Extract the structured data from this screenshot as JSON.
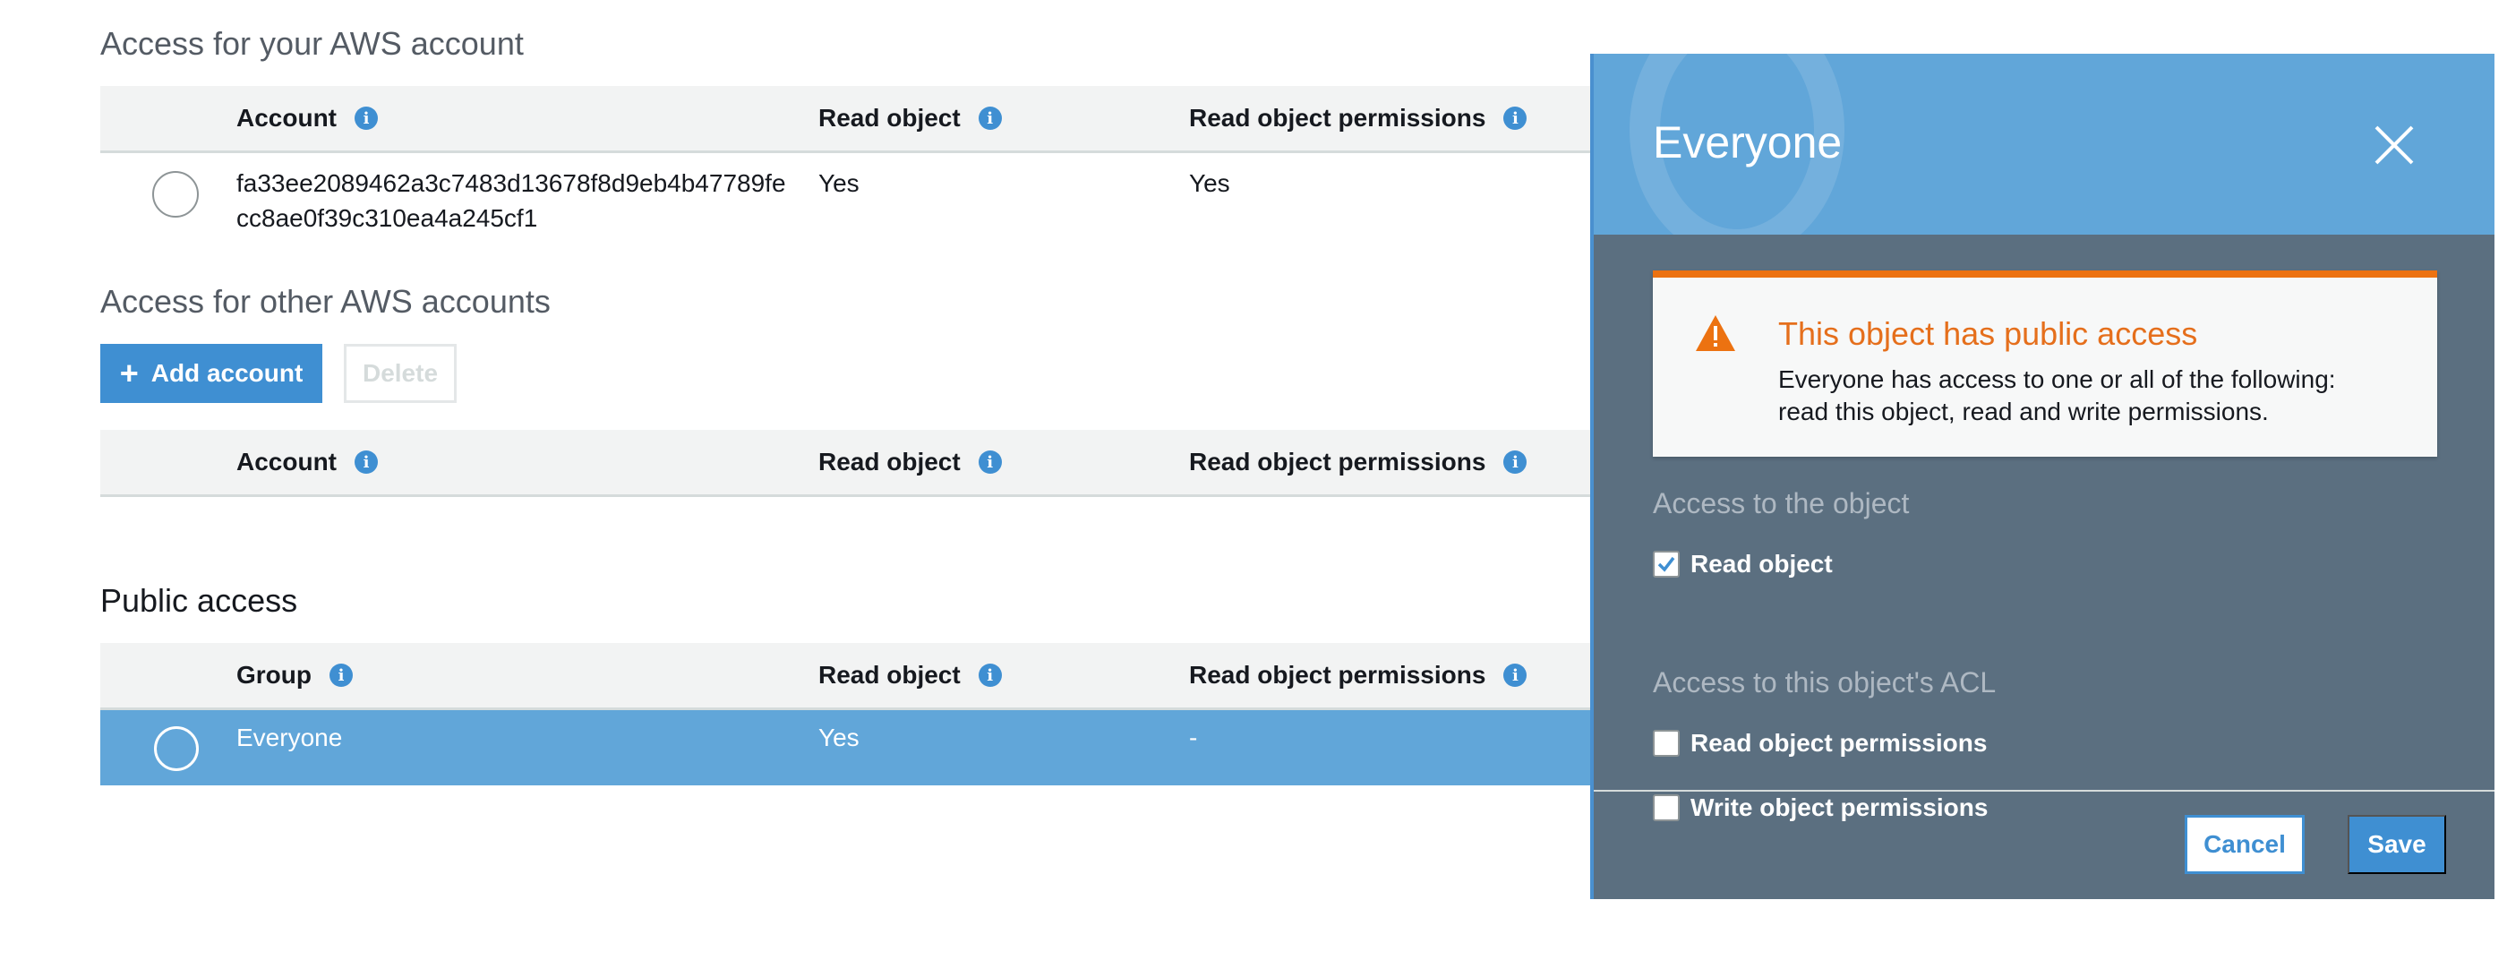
{
  "aws_account_section": {
    "title": "Access for your AWS account",
    "headers": {
      "account": "Account",
      "read_object": "Read object",
      "read_permissions": "Read object permissions"
    },
    "row": {
      "account_line1": "fa33ee2089462a3c7483d13678f8d9eb4b47789fe",
      "account_line2": "cc8ae0f39c310ea4a245cf1",
      "read_object": "Yes",
      "read_permissions": "Yes"
    }
  },
  "other_accounts_section": {
    "title": "Access for other AWS accounts",
    "add_button": "Add account",
    "delete_button": "Delete",
    "headers": {
      "account": "Account",
      "read_object": "Read object",
      "read_permissions": "Read object permissions"
    }
  },
  "public_access_section": {
    "title": "Public access",
    "headers": {
      "group": "Group",
      "read_object": "Read object",
      "read_permissions": "Read object permissions"
    },
    "row": {
      "group": "Everyone",
      "read_object": "Yes",
      "read_permissions": "-"
    }
  },
  "panel": {
    "title": "Everyone",
    "alert": {
      "title": "This object has public access",
      "line1": "Everyone has access to one or all of the following:",
      "line2": "read this object, read and write permissions."
    },
    "object_access_title": "Access to the object",
    "read_object_label": "Read object",
    "acl_title": "Access to this object's ACL",
    "read_permissions_label": "Read object permissions",
    "write_permissions_label": "Write object permissions",
    "cancel": "Cancel",
    "save": "Save"
  },
  "colors": {
    "primary_blue": "#3f8fd2",
    "selected_row": "#61a6d9",
    "warning_orange": "#ec7211",
    "panel_body": "#5b6f80"
  },
  "icons": {
    "info": "info-icon",
    "plus": "plus-icon",
    "close": "close-icon",
    "warning": "warning-icon",
    "check": "checkmark-icon"
  }
}
